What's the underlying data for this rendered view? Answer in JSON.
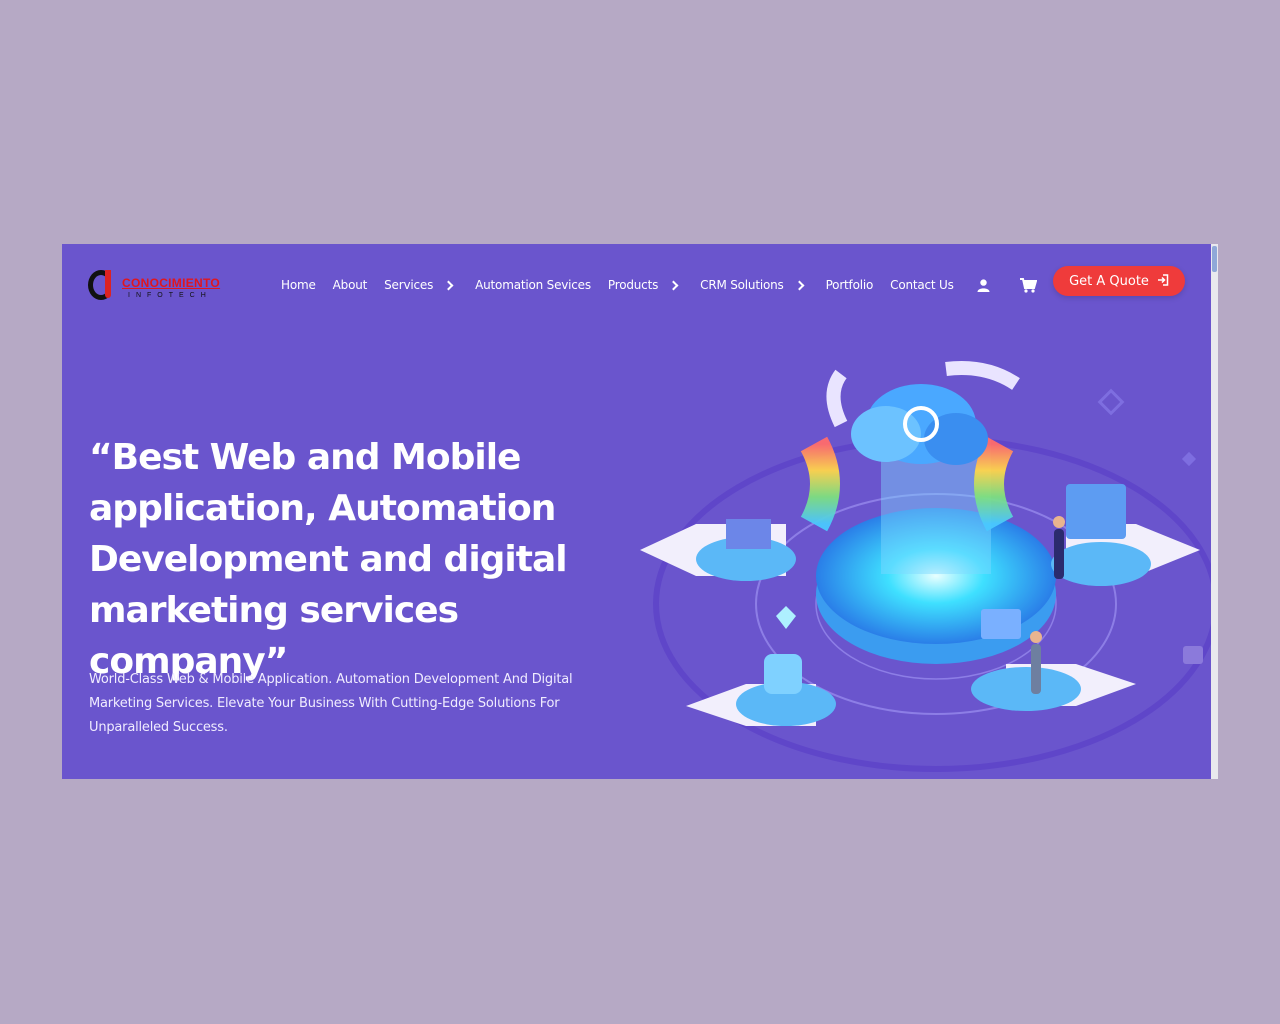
{
  "logo": {
    "name": "CONOCIMIENTO",
    "sub": "INFOTECH"
  },
  "nav": {
    "items": [
      {
        "label": "Home"
      },
      {
        "label": "About"
      },
      {
        "label": "Services"
      },
      {
        "label": "Automation Sevices"
      },
      {
        "label": "Products"
      },
      {
        "label": "CRM Solutions"
      },
      {
        "label": "Portfolio"
      },
      {
        "label": "Contact Us"
      }
    ],
    "user_icon": "user-icon",
    "cart_icon": "cart-icon"
  },
  "cta": {
    "label": "Get A Quote",
    "icon": "sign-in-icon"
  },
  "hero": {
    "title": "“Best Web and Mobile application, Automation Development and digital marketing services company”",
    "subtitle": "World-Class Web & Mobile Application. Automation Development And Digital Marketing Services. Elevate Your Business With Cutting-Edge Solutions For Unparalleled Success."
  },
  "colors": {
    "page_bg": "#b6a9c5",
    "hero_bg": "#6a55cd",
    "cta_bg": "#ef3b3b",
    "brand_red": "#e0161e"
  }
}
